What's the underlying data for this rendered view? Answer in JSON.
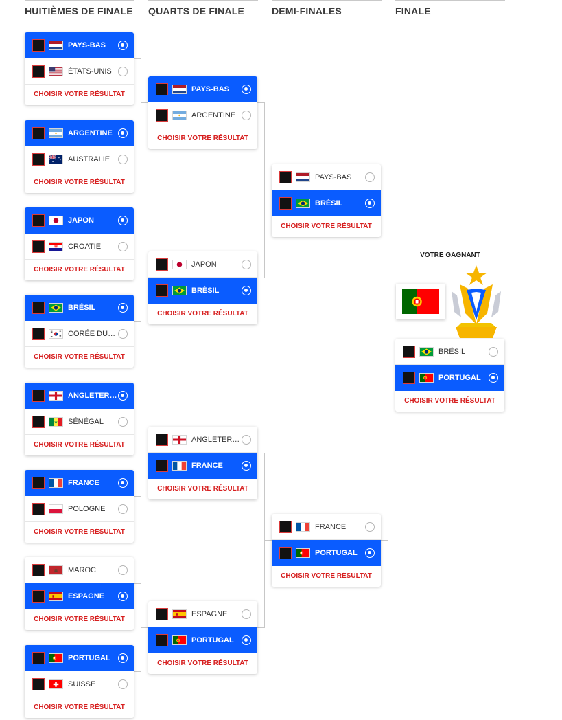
{
  "columns": [
    "HUITIÈMES DE FINALE",
    "QUARTS DE FINALE",
    "DEMI-FINALES",
    "FINALE"
  ],
  "result_label": "CHOISIR VOTRE RÉSULTAT",
  "winner": {
    "title": "VOTRE GAGNANT",
    "team": "PORTUGAL",
    "flag": "PT"
  },
  "rounds": [
    {
      "name": "HUITIÈMES DE FINALE",
      "matches": [
        {
          "teams": [
            {
              "name": "PAYS-BAS",
              "flag": "NL",
              "selected": true
            },
            {
              "name": "ÉTATS-UNIS",
              "flag": "US",
              "selected": false
            }
          ]
        },
        {
          "teams": [
            {
              "name": "ARGENTINE",
              "flag": "AR",
              "selected": true
            },
            {
              "name": "AUSTRALIE",
              "flag": "AU",
              "selected": false
            }
          ]
        },
        {
          "teams": [
            {
              "name": "JAPON",
              "flag": "JP",
              "selected": true
            },
            {
              "name": "CROATIE",
              "flag": "HR",
              "selected": false
            }
          ]
        },
        {
          "teams": [
            {
              "name": "BRÉSIL",
              "flag": "BR",
              "selected": true
            },
            {
              "name": "CORÉE DU SUD",
              "flag": "KR",
              "selected": false
            }
          ]
        },
        {
          "teams": [
            {
              "name": "ANGLETERRE",
              "flag": "EN",
              "selected": true
            },
            {
              "name": "SÉNÉGAL",
              "flag": "SN",
              "selected": false
            }
          ]
        },
        {
          "teams": [
            {
              "name": "FRANCE",
              "flag": "FR",
              "selected": true
            },
            {
              "name": "POLOGNE",
              "flag": "PL",
              "selected": false
            }
          ]
        },
        {
          "teams": [
            {
              "name": "MAROC",
              "flag": "MA",
              "selected": false
            },
            {
              "name": "ESPAGNE",
              "flag": "ES",
              "selected": true
            }
          ]
        },
        {
          "teams": [
            {
              "name": "PORTUGAL",
              "flag": "PT",
              "selected": true
            },
            {
              "name": "SUISSE",
              "flag": "CH",
              "selected": false
            }
          ]
        }
      ]
    },
    {
      "name": "QUARTS DE FINALE",
      "matches": [
        {
          "teams": [
            {
              "name": "PAYS-BAS",
              "flag": "NL",
              "selected": true
            },
            {
              "name": "ARGENTINE",
              "flag": "AR",
              "selected": false
            }
          ]
        },
        {
          "teams": [
            {
              "name": "JAPON",
              "flag": "JP",
              "selected": false
            },
            {
              "name": "BRÉSIL",
              "flag": "BR",
              "selected": true
            }
          ]
        },
        {
          "teams": [
            {
              "name": "ANGLETERRE",
              "flag": "EN",
              "selected": false
            },
            {
              "name": "FRANCE",
              "flag": "FR",
              "selected": true
            }
          ]
        },
        {
          "teams": [
            {
              "name": "ESPAGNE",
              "flag": "ES",
              "selected": false
            },
            {
              "name": "PORTUGAL",
              "flag": "PT",
              "selected": true
            }
          ]
        }
      ]
    },
    {
      "name": "DEMI-FINALES",
      "matches": [
        {
          "teams": [
            {
              "name": "PAYS-BAS",
              "flag": "NL",
              "selected": false
            },
            {
              "name": "BRÉSIL",
              "flag": "BR",
              "selected": true
            }
          ]
        },
        {
          "teams": [
            {
              "name": "FRANCE",
              "flag": "FR",
              "selected": false
            },
            {
              "name": "PORTUGAL",
              "flag": "PT",
              "selected": true
            }
          ]
        }
      ]
    },
    {
      "name": "FINALE",
      "matches": [
        {
          "teams": [
            {
              "name": "BRÉSIL",
              "flag": "BR",
              "selected": false
            },
            {
              "name": "PORTUGAL",
              "flag": "PT",
              "selected": true
            }
          ]
        }
      ]
    }
  ]
}
